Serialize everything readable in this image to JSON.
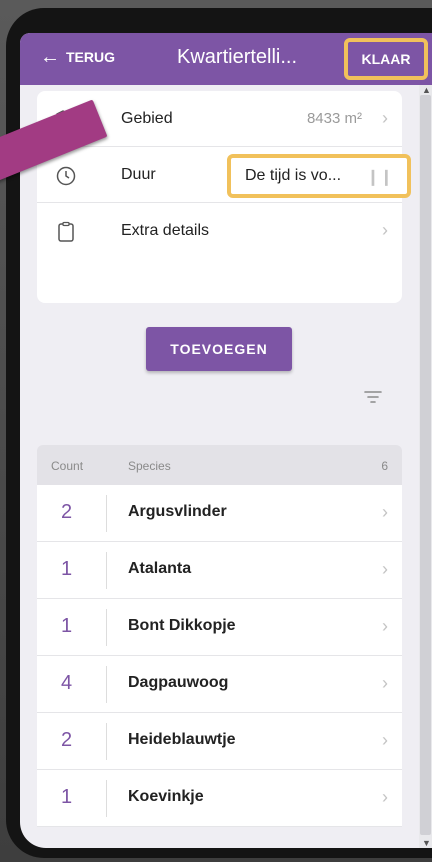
{
  "appbar": {
    "back_label": "TERUG",
    "title": "Kwartiertelli...",
    "done_label": "KLAAR"
  },
  "details": {
    "area_label": "Gebied",
    "area_value": "8433 m²",
    "duration_label": "Duur",
    "duration_value": "De tijd is vo...",
    "extra_label": "Extra details"
  },
  "add_button": "TOEVOEGEN",
  "list": {
    "header_count": "Count",
    "header_species": "Species",
    "total": "6",
    "items": [
      {
        "count": "2",
        "name": "Argusvlinder"
      },
      {
        "count": "1",
        "name": "Atalanta"
      },
      {
        "count": "1",
        "name": "Bont Dikkopje"
      },
      {
        "count": "4",
        "name": "Dagpauwoog"
      },
      {
        "count": "2",
        "name": "Heideblauwtje"
      },
      {
        "count": "1",
        "name": "Koevinkje"
      }
    ]
  },
  "icons": {
    "area": "map-icon",
    "duration": "clock-icon",
    "extra": "clipboard-icon",
    "filter": "filter-icon"
  },
  "colors": {
    "primary": "#7d55a5",
    "highlight": "#f1c15b",
    "pointer": "#a23b83"
  }
}
